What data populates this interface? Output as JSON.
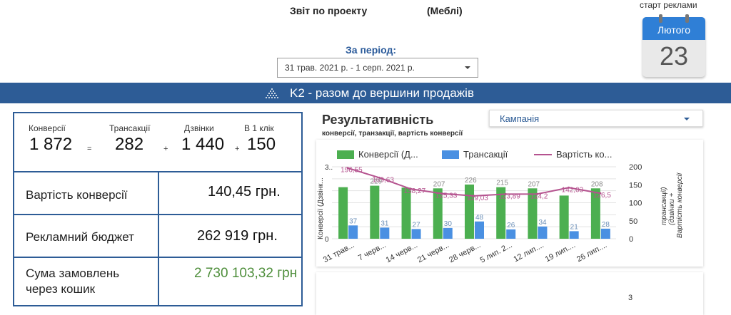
{
  "header": {
    "report_title_prefix": "Звіт по проекту",
    "report_title_project": "(Меблі)",
    "period_label": "За період:",
    "period_value": "31 трав. 2021 р. - 1 серп. 2021 р.",
    "ad_start_label": "старт реклами",
    "calendar_month": "Лютого",
    "calendar_day": "23"
  },
  "banner": {
    "text": "K2 - разом до вершини продажів"
  },
  "kpis": {
    "conversions_label": "Конверсії",
    "conversions_value": "1 872",
    "equals": "=",
    "transactions_label": "Трансакції",
    "transactions_value": "282",
    "plus1": "+",
    "calls_label": "Дзвінки",
    "calls_value": "1 440",
    "plus2": "+",
    "oneclick_label": "В 1 клік",
    "oneclick_value": "150"
  },
  "stats": {
    "cost_label": "Вартість конверсії",
    "cost_value": "140,45 грн.",
    "budget_label": "Рекламний бюджет",
    "budget_value": "262 919 грн.",
    "orders_label_1": "Сума  замовлень",
    "orders_label_2": "через кошик",
    "orders_value": "2 730 103,32 грн"
  },
  "chart_panel": {
    "title": "Результативність",
    "subtitle": "конверсії, транзакції, вартість конверсії",
    "campaign_dropdown": "Кампанія",
    "legend_conv": "Конверсії (Д...",
    "legend_trans": "Трансакції",
    "legend_cost": "Вартість ко...",
    "left_axis_title": "Конверсії (Дзвінк...",
    "right_axis_title_1": "трансакції)",
    "right_axis_title_2": "(дзвінки +",
    "right_axis_title_3": "Вартість конверсії",
    "left_top_tick": "3..",
    "lower_panel_tick": "3"
  },
  "colors": {
    "banner": "#2d5c96",
    "bar_conversions": "#4caf50",
    "bar_transactions": "#4a90e2",
    "line_cost": "#b5538f",
    "orders_value": "#4f8f3c"
  },
  "chart_data": {
    "type": "bar",
    "x_tick_labels": [
      "31 трав...",
      "7 черв...",
      "14 черв...",
      "21 черв...",
      "28 черв...",
      "5 лип. 2...",
      "12 лип....",
      "19 лип....",
      "26 лип...."
    ],
    "series": [
      {
        "name": "Конверсії (Д...",
        "type": "bar",
        "axis": "left",
        "data_labels": [
          "",
          "219",
          "",
          "207",
          "226",
          "215",
          "207",
          "",
          "208"
        ],
        "relative_values": [
          2.15,
          2.21,
          2.13,
          2.1,
          2.26,
          2.15,
          2.1,
          1.8,
          2.1
        ]
      },
      {
        "name": "Трансакції",
        "type": "bar",
        "axis": "left",
        "values": [
          37,
          31,
          27,
          30,
          48,
          26,
          34,
          21,
          28
        ]
      },
      {
        "name": "Вартість ко...",
        "type": "line",
        "axis": "right",
        "values": [
          196.55,
          169.63,
          138.27,
          125.33,
          119.03,
          123.89,
          124.2,
          142.03,
          126.5
        ],
        "data_labels": [
          "196,55",
          "169,63",
          "138,27",
          "125,33",
          "119,03",
          "123,89",
          "124,2",
          "142,03",
          "126,5"
        ]
      }
    ],
    "left_axis_ticks": [
      "3..",
      "",
      "",
      "",
      "",
      "",
      "0"
    ],
    "right_axis_ticks": [
      "200",
      "150",
      "100",
      "50",
      "0"
    ],
    "right_ylim": [
      0,
      200
    ],
    "grid": true,
    "legend_position": "top"
  }
}
